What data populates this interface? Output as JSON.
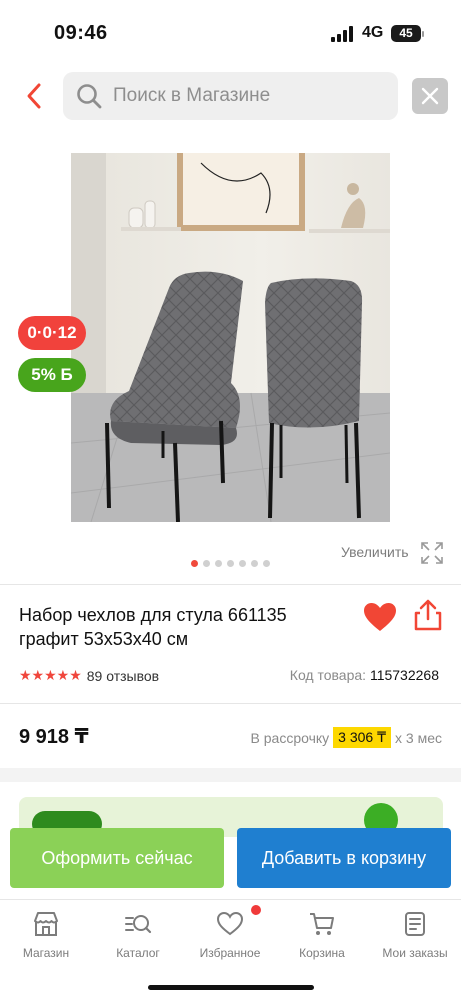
{
  "status_bar": {
    "time": "09:46",
    "network": "4G",
    "battery": "45"
  },
  "search": {
    "placeholder": "Поиск в Магазине"
  },
  "badges": {
    "installment": "0·0·12",
    "bonus": "5% Б"
  },
  "gallery": {
    "zoom_label": "Увеличить",
    "dots_total": 7,
    "active_dot": 1
  },
  "product": {
    "title": "Набор чехлов для стула 661135 графит 53x53x40 см",
    "rating": 5,
    "reviews": "89 отзывов",
    "sku_label": "Код товара:",
    "sku": "115732268",
    "price": "9 918 ₸",
    "installment_prefix": "В рассрочку",
    "installment_amount": "3 306 ₸",
    "installment_suffix": "x 3 мес"
  },
  "actions": {
    "buy_now": "Оформить сейчас",
    "add_to_cart": "Добавить в корзину"
  },
  "tabbar": {
    "items": [
      {
        "label": "Магазин",
        "icon": "shop-icon"
      },
      {
        "label": "Каталог",
        "icon": "catalog-icon"
      },
      {
        "label": "Избранное",
        "icon": "heart-icon"
      },
      {
        "label": "Корзина",
        "icon": "cart-icon"
      },
      {
        "label": "Мои заказы",
        "icon": "orders-icon"
      }
    ]
  },
  "colors": {
    "accent_red": "#f14635",
    "brand_blue": "#1f7fd0",
    "buy_green": "#8bd157",
    "installment_yellow": "#fdd800"
  }
}
